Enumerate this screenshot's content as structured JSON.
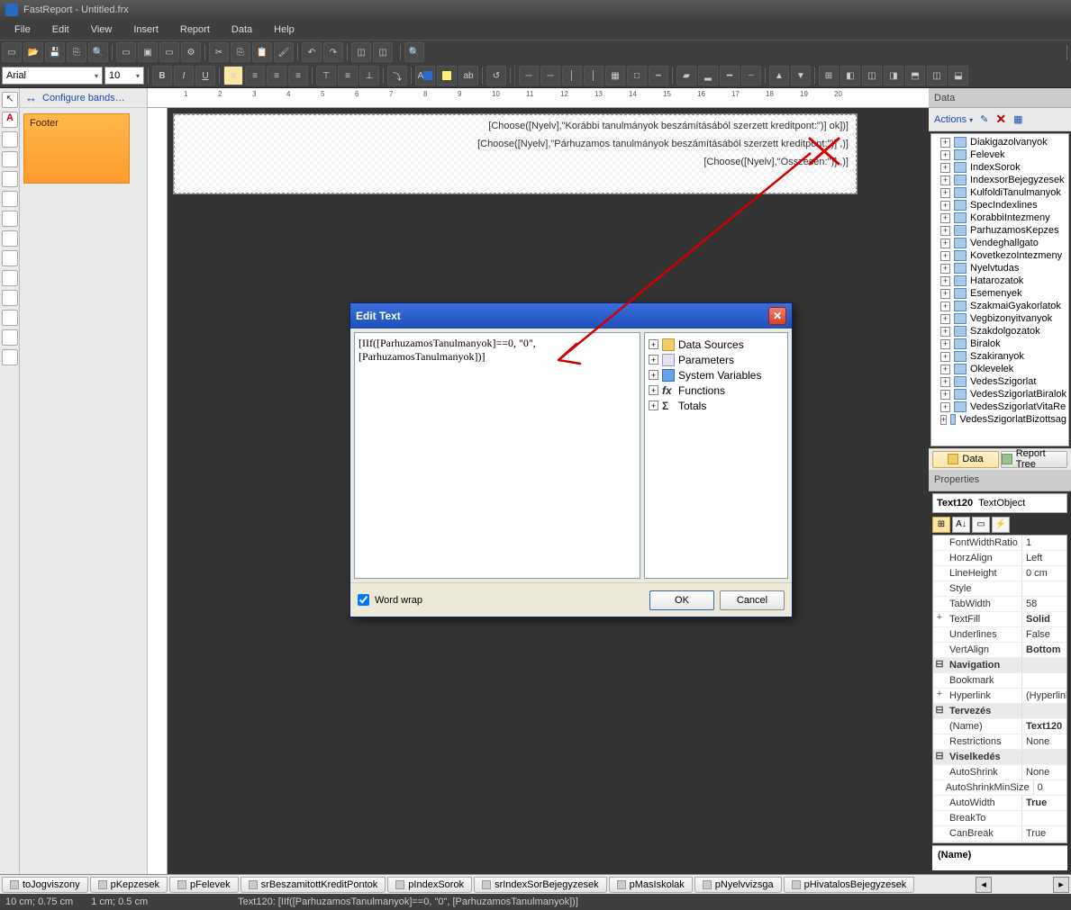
{
  "titlebar": {
    "title": "FastReport - Untitled.frx"
  },
  "menu": {
    "file": "File",
    "edit": "Edit",
    "view": "View",
    "insert": "Insert",
    "report": "Report",
    "data": "Data",
    "help": "Help"
  },
  "format_toolbar": {
    "font": "Arial",
    "size": "10"
  },
  "band_panel": {
    "header": "Configure bands…",
    "footer_label": "Footer"
  },
  "ruler": {
    "marks": [
      "1",
      "2",
      "3",
      "4",
      "5",
      "6",
      "7",
      "8",
      "9",
      "10",
      "11",
      "12",
      "13",
      "14",
      "15",
      "16",
      "17",
      "18",
      "19",
      "20"
    ]
  },
  "sheet": {
    "row1": "[Choose([Nyelv],\"Korábbi tanulmányok beszámításából szerzett kreditpont:\")]  ok])]",
    "row2": "[Choose([Nyelv],\"Párhuzamos tanulmányok beszámításából  szerzett kreditpont:\")]  ,)]",
    "row3": "[Choose([Nyelv],\"Összesen:\")]  ,)]"
  },
  "data_panel": {
    "title": "Data",
    "actions_label": "Actions",
    "tree": [
      "Diakigazolvanyok",
      "Felevek",
      "IndexSorok",
      "IndexsorBejegyzesek",
      "KulfoldiTanulmanyok",
      "SpecIndexlines",
      "KorabbiIntezmeny",
      "ParhuzamosKepzes",
      "Vendeghallgato",
      "KovetkezoIntezmeny",
      "Nyelvtudas",
      "Hatarozatok",
      "Esemenyek",
      "SzakmaiGyakorlatok",
      "Vegbizonyitvanyok",
      "Szakdolgozatok",
      "Biralok",
      "Szakiranyok",
      "Oklevelek",
      "VedesSzigorlat",
      "VedesSzigorlatBiralok",
      "VedesSzigorlatVitaRe",
      "VedesSzigorlatBizottsag"
    ],
    "tab_data": "Data",
    "tab_tree": "Report Tree"
  },
  "properties": {
    "title": "Properties",
    "object_name": "Text120",
    "object_type": "TextObject",
    "rows": [
      {
        "exp": "",
        "name": "FontWidthRatio",
        "val": "1"
      },
      {
        "exp": "",
        "name": "HorzAlign",
        "val": "Left"
      },
      {
        "exp": "",
        "name": "LineHeight",
        "val": "0 cm"
      },
      {
        "exp": "",
        "name": "Style",
        "val": ""
      },
      {
        "exp": "",
        "name": "TabWidth",
        "val": "58"
      },
      {
        "exp": "+",
        "name": "TextFill",
        "val": "Solid",
        "bold": true
      },
      {
        "exp": "",
        "name": "Underlines",
        "val": "False"
      },
      {
        "exp": "",
        "name": "VertAlign",
        "val": "Bottom",
        "bold": true
      }
    ],
    "cat_nav": "Navigation",
    "nav_rows": [
      {
        "exp": "",
        "name": "Bookmark",
        "val": ""
      },
      {
        "exp": "+",
        "name": "Hyperlink",
        "val": "(Hyperlink)"
      }
    ],
    "cat_terv": "Tervezés",
    "terv_rows": [
      {
        "exp": "",
        "name": "(Name)",
        "val": "Text120",
        "bold": true
      },
      {
        "exp": "",
        "name": "Restrictions",
        "val": "None"
      }
    ],
    "cat_visel": "Viselkedés",
    "visel_rows": [
      {
        "exp": "",
        "name": "AutoShrink",
        "val": "None"
      },
      {
        "exp": "",
        "name": "AutoShrinkMinSize",
        "val": "0"
      },
      {
        "exp": "",
        "name": "AutoWidth",
        "val": "True",
        "bold": true
      },
      {
        "exp": "",
        "name": "BreakTo",
        "val": ""
      },
      {
        "exp": "",
        "name": "CanBreak",
        "val": "True"
      }
    ],
    "footer": "(Name)"
  },
  "dialog": {
    "title": "Edit Text",
    "text": "[IIf([ParhuzamosTanulmanyok]==0, \"0\",\n[ParhuzamosTanulmanyok])]",
    "tree": {
      "ds": "Data Sources",
      "params": "Parameters",
      "sys": "System Variables",
      "fx": "Functions",
      "totals": "Totals"
    },
    "wordwrap": "Word wrap",
    "ok": "OK",
    "cancel": "Cancel"
  },
  "page_tabs": [
    "toJogviszony",
    "pKepzesek",
    "pFelevek",
    "srBeszamitottKreditPontok",
    "pIndexSorok",
    "srIndexSorBejegyzesek",
    "pMasIskolak",
    "pNyelvvizsga",
    "pHivatalosBejegyzesek"
  ],
  "status": {
    "pos1": "10 cm; 0.75 cm",
    "pos2": "1 cm; 0.5 cm",
    "selinfo": "Text120:  [IIf([ParhuzamosTanulmanyok]==0, \"0\", [ParhuzamosTanulmanyok])]"
  }
}
